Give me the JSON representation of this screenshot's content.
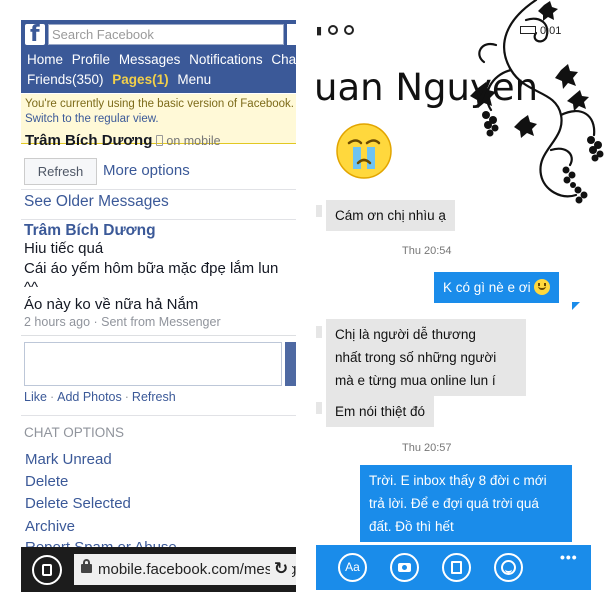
{
  "left": {
    "header": {
      "logo": "f",
      "search_placeholder": "Search Facebook",
      "nav_row1": [
        "Home",
        "Profile",
        "Messages",
        "Notifications",
        "Chat"
      ],
      "nav_row2": {
        "friends": "Friends(350)",
        "pages": "Pages(1)",
        "menu": "Menu"
      }
    },
    "notice": {
      "line1": "You're currently using the basic version of Facebook.",
      "line2": "Switch to the regular view."
    },
    "conversation": {
      "name": "Trâm Bích Dương",
      "status": "on mobile",
      "refresh_label": "Refresh",
      "more_options_label": "More options"
    },
    "older_messages_label": "See Older Messages",
    "message": {
      "sender": "Trâm Bích Dương",
      "lines": [
        "Hiu tiếc quá",
        "Cái áo yếm hôm bữa mặc đpẹ lắm lun",
        "^^",
        "Áo này ko về nữa hả Nắm"
      ],
      "meta": "2 hours ago · Sent from Messenger"
    },
    "reply_actions": {
      "like": "Like",
      "add_photos": "Add Photos",
      "refresh": "Refresh"
    },
    "chat_options": {
      "heading": "CHAT OPTIONS",
      "items": [
        "Mark Unread",
        "Delete",
        "Delete Selected",
        "Archive",
        "Report Spam or Abuse"
      ]
    },
    "browser": {
      "url": "mobile.facebook.com/messages"
    }
  },
  "right": {
    "status_bar": {
      "time": "0:01"
    },
    "contact_name": "uan Nguyen",
    "messages": [
      {
        "dir": "in",
        "text": "Cám ơn chị nhìu ạ"
      },
      {
        "dir": "time",
        "text": "Thu 20:54"
      },
      {
        "dir": "out",
        "text": "K có gì nè e ơi"
      },
      {
        "dir": "in",
        "lines": [
          "Chị là người dễ thương",
          "nhất trong số những người",
          "mà e từng mua online lun í"
        ]
      },
      {
        "dir": "in",
        "text": "Em nói thiệt đó"
      },
      {
        "dir": "time",
        "text": "Thu 20:57"
      },
      {
        "dir": "out",
        "lines": [
          "Trời. E inbox thấy 8 đời c mới",
          "trả lời. Để e đợi quá trời quá",
          "đất. Đồ thì hết"
        ]
      }
    ],
    "app_bar": {
      "text_button": "Aa",
      "more": "•••"
    },
    "colors": {
      "accent": "#1a8cea",
      "facebook": "#3b5998",
      "bubble_in": "#e6e6e6"
    }
  }
}
